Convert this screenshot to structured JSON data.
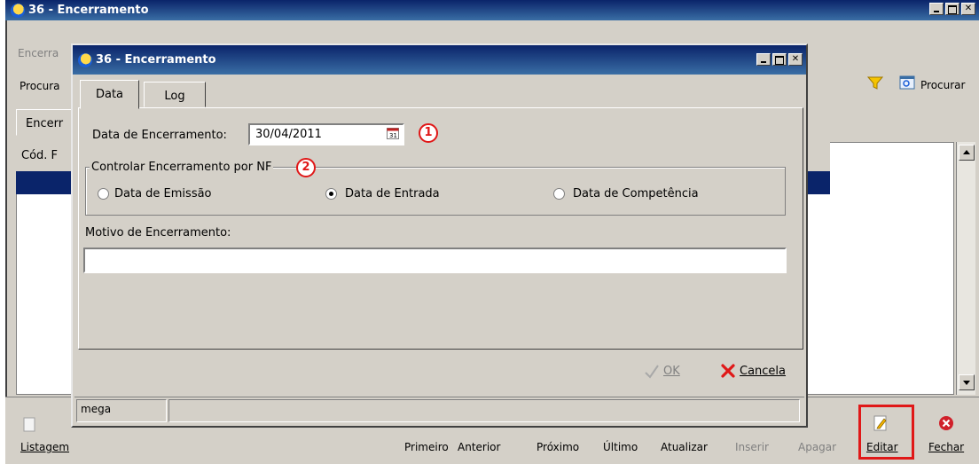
{
  "main_window": {
    "title": "36 - Encerramento",
    "menu_label": "Encerra",
    "search_label": "Procura",
    "procurar_label": "Procurar",
    "tab_label": "Encerr",
    "column_header": "Cód. F"
  },
  "dialog": {
    "title": "36 - Encerramento",
    "tabs": [
      "Data",
      "Log"
    ],
    "date_label": "Data de Encerramento:",
    "date_value": "30/04/2011",
    "group_label": "Controlar Encerramento por NF",
    "radio_options": [
      {
        "label": "Data de Emissão",
        "checked": false
      },
      {
        "label": "Data de Entrada",
        "checked": true
      },
      {
        "label": "Data de Competência",
        "checked": false
      }
    ],
    "motivo_label": "Motivo de Encerramento:",
    "motivo_value": "",
    "ok_label": "OK",
    "cancel_label": "Cancela",
    "status_text": "mega",
    "markers": [
      "1",
      "2"
    ]
  },
  "toolbar": {
    "listagem": "Listagem",
    "primeiro": "Primeiro",
    "anterior": "Anterior",
    "proximo": "Próximo",
    "ultimo": "Último",
    "atualizar": "Atualizar",
    "inserir": "Inserir",
    "apagar": "Apagar",
    "editar": "Editar",
    "fechar": "Fechar"
  },
  "colors": {
    "title_blue": "#0a246a",
    "highlight_red": "#e01818",
    "window_gray": "#d4d0c8"
  }
}
